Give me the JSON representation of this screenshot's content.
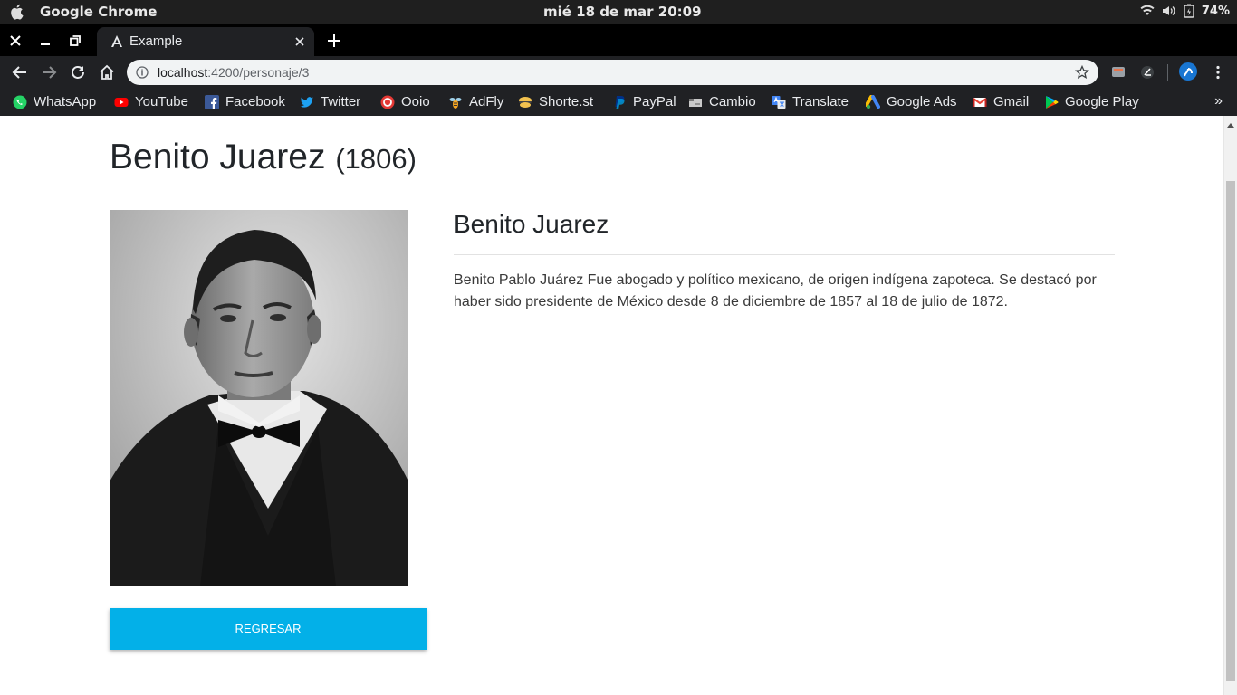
{
  "os": {
    "app_name": "Google Chrome",
    "clock": "mié 18 de mar 20:09",
    "battery": "74%"
  },
  "browser": {
    "tab_title": "Example",
    "url_host": "localhost",
    "url_path": ":4200/personaje/3",
    "bookmarks": [
      {
        "label": "WhatsApp",
        "icon": "whatsapp-icon",
        "color": "#25d366"
      },
      {
        "label": "YouTube",
        "icon": "youtube-icon",
        "color": "#ff0000"
      },
      {
        "label": "Facebook",
        "icon": "facebook-icon",
        "color": "#3b5998"
      },
      {
        "label": "Twitter",
        "icon": "twitter-icon",
        "color": "#1da1f2"
      },
      {
        "label": "Ooio",
        "icon": "ooio-icon",
        "color": "#e53935"
      },
      {
        "label": "AdFly",
        "icon": "adfly-icon",
        "color": "#f5a623"
      },
      {
        "label": "Shorte.st",
        "icon": "shortest-icon",
        "color": "#f2c14e"
      },
      {
        "label": "PayPal",
        "icon": "paypal-icon",
        "color": "#003087"
      },
      {
        "label": "Cambio",
        "icon": "cambio-icon",
        "color": "#c9c9c9"
      },
      {
        "label": "Translate",
        "icon": "translate-icon",
        "color": "#4285f4"
      },
      {
        "label": "Google Ads",
        "icon": "google-ads-icon",
        "color": "#fbbc04"
      },
      {
        "label": "Gmail",
        "icon": "gmail-icon",
        "color": "#ea4335"
      },
      {
        "label": "Google Play",
        "icon": "google-play-icon",
        "color": "#00c853"
      }
    ],
    "more_label": "»"
  },
  "page": {
    "title": "Benito Juarez",
    "year": "(1806)",
    "character_name": "Benito Juarez",
    "bio": "Benito Pablo Juárez Fue abogado y político mexicano, de origen indígena zapoteca. Se destacó por haber sido presidente de México desde 8 de diciembre de 1857 al 18 de julio de 1872.",
    "back_button": "REGRESAR",
    "button_color": "#03b0e8"
  }
}
